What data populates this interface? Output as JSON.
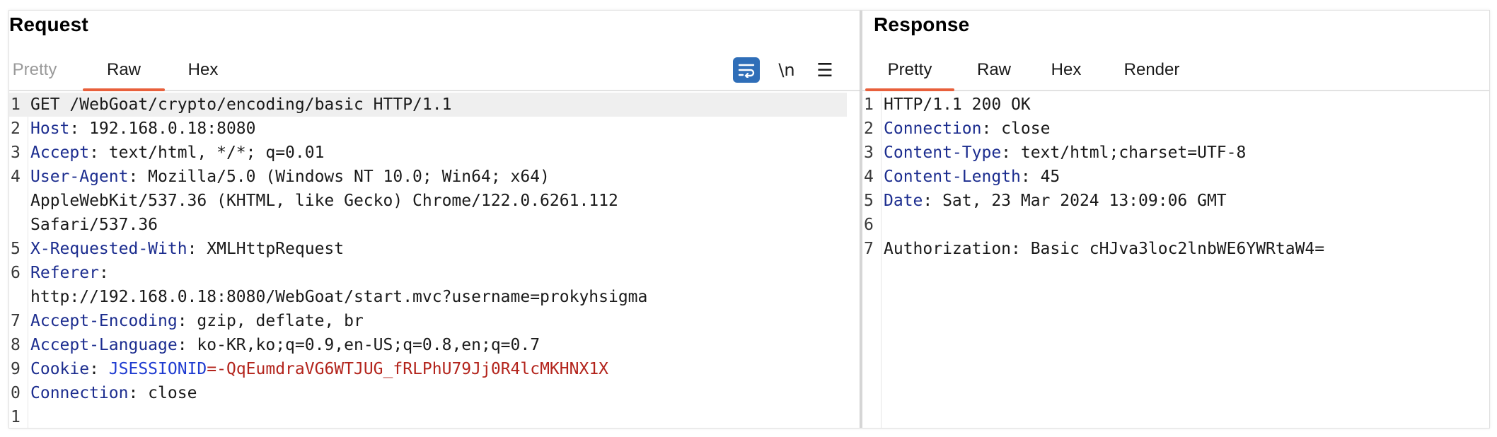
{
  "request": {
    "title": "Request",
    "tabs": {
      "pretty": "Pretty",
      "raw": "Raw",
      "hex": "Hex"
    },
    "toolbar": {
      "newline_label": "\\n",
      "menu_glyph": "☰"
    },
    "lines": [
      {
        "num": "1",
        "text": "GET /WebGoat/crypto/encoding/basic HTTP/1.1"
      },
      {
        "num": "2",
        "key": "Host",
        "value": ": 192.168.0.18:8080"
      },
      {
        "num": "3",
        "key": "Accept",
        "value": ": text/html, */*; q=0.01"
      },
      {
        "num": "4",
        "key": "User-Agent",
        "value": ": Mozilla/5.0 (Windows NT 10.0; Win64; x64)"
      },
      {
        "cont": "AppleWebKit/537.36 (KHTML, like Gecko) Chrome/122.0.6261.112"
      },
      {
        "cont": "Safari/537.36"
      },
      {
        "num": "5",
        "key": "X-Requested-With",
        "value": ": XMLHttpRequest"
      },
      {
        "num": "6",
        "key": "Referer",
        "value": ":"
      },
      {
        "cont": "http://192.168.0.18:8080/WebGoat/start.mvc?username=prokyhsigma"
      },
      {
        "num": "7",
        "key": "Accept-Encoding",
        "value": ": gzip, deflate, br"
      },
      {
        "num": "8",
        "key": "Accept-Language",
        "value": ": ko-KR,ko;q=0.9,en-US;q=0.8,en;q=0.7"
      },
      {
        "num": "9",
        "key": "Cookie",
        "value": ": ",
        "cookie_name": "JSESSIONID",
        "cookie_value": "=-QqEumdraVG6WTJUG_fRLPhU79Jj0R4lcMKHNX1X"
      },
      {
        "num": "0",
        "key": "Connection",
        "value": ": close"
      },
      {
        "num": "1",
        "text": ""
      }
    ]
  },
  "response": {
    "title": "Response",
    "tabs": {
      "pretty": "Pretty",
      "raw": "Raw",
      "hex": "Hex",
      "render": "Render"
    },
    "lines": [
      {
        "num": "1",
        "text": "HTTP/1.1 200 OK"
      },
      {
        "num": "2",
        "key": "Connection",
        "value": ": close"
      },
      {
        "num": "3",
        "key": "Content-Type",
        "value": ": text/html;charset=UTF-8"
      },
      {
        "num": "4",
        "key": "Content-Length",
        "value": ": 45"
      },
      {
        "num": "5",
        "key": "Date",
        "value": ": Sat, 23 Mar 2024 13:09:06 GMT"
      },
      {
        "num": "6",
        "text": ""
      },
      {
        "num": "7",
        "text": "Authorization: Basic cHJva3loc2lnbWE6YWRtaW4="
      }
    ]
  },
  "colors": {
    "accent": "#e8603c",
    "wrap_button": "#2f6eb8",
    "header_key": "#1c2d8f",
    "cookie_value": "#b3241c"
  }
}
